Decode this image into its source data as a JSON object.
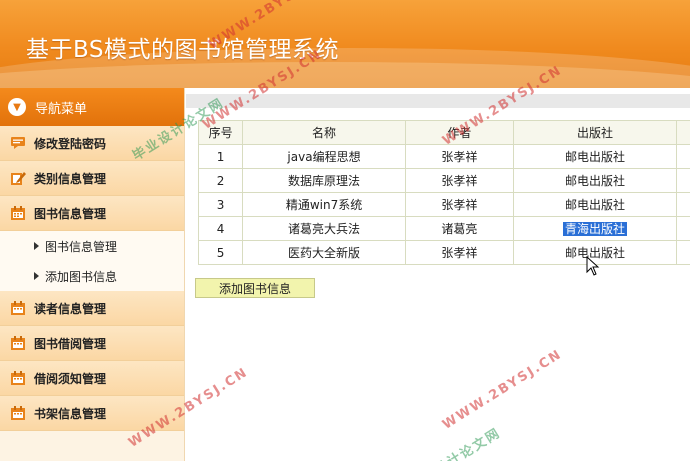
{
  "header": {
    "title": "基于BS模式的图书馆管理系统"
  },
  "sidebar": {
    "nav_title": "导航菜单",
    "items": [
      {
        "label": "修改登陆密码",
        "icon": "comment-icon"
      },
      {
        "label": "类别信息管理",
        "icon": "edit-icon"
      },
      {
        "label": "图书信息管理",
        "icon": "calendar-icon"
      },
      {
        "label": "读者信息管理",
        "icon": "calendar-icon"
      },
      {
        "label": "图书借阅管理",
        "icon": "calendar-icon"
      },
      {
        "label": "借阅须知管理",
        "icon": "calendar-icon"
      },
      {
        "label": "书架信息管理",
        "icon": "calendar-icon"
      }
    ],
    "sub_items": [
      "图书信息管理",
      "添加图书信息"
    ]
  },
  "table": {
    "columns": [
      "序号",
      "名称",
      "作者",
      "出版社"
    ],
    "rows": [
      [
        "1",
        "java编程思想",
        "张孝祥",
        "邮电出版社"
      ],
      [
        "2",
        "数据库原理法",
        "张孝祥",
        "邮电出版社"
      ],
      [
        "3",
        "精通win7系统",
        "张孝祥",
        "邮电出版社"
      ],
      [
        "4",
        "诸葛亮大兵法",
        "诸葛亮",
        "青海出版社"
      ],
      [
        "5",
        "医药大全新版",
        "张孝祥",
        "邮电出版社"
      ]
    ]
  },
  "add_button": "添加图书信息",
  "watermarks": {
    "url": "WWW.2BYSJ.CN",
    "site": "毕业设计论文网",
    "site_partial": "设计论文网"
  },
  "colors": {
    "accent": "#f08a1e",
    "sidebar_bg": "#fdf3e3",
    "selection": "#2a6fd6"
  }
}
